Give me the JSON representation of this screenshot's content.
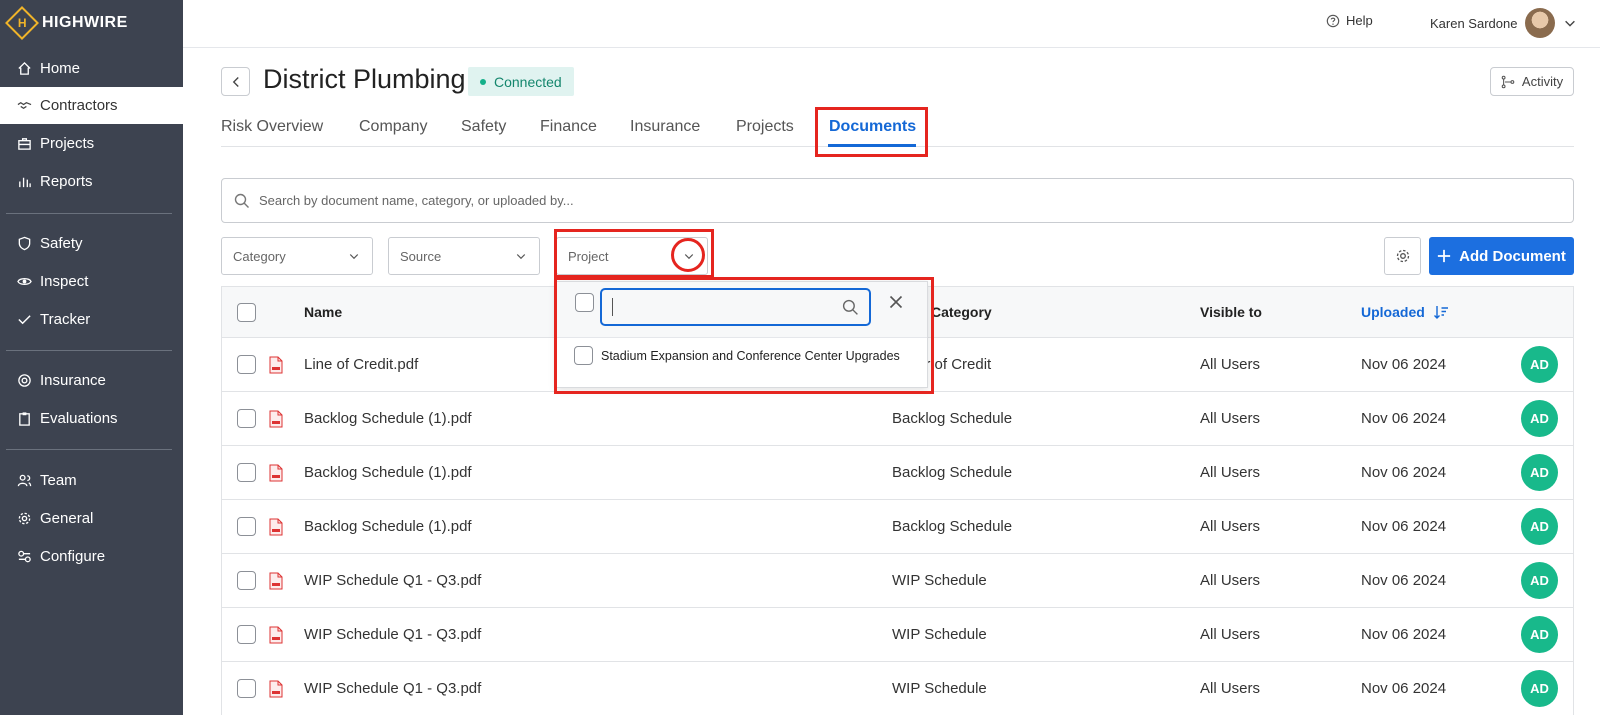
{
  "app": {
    "logo_letter": "H",
    "logo_text": "HIGHWIRE"
  },
  "sidebar": {
    "items": [
      {
        "label": "Home",
        "icon": "home-icon"
      },
      {
        "label": "Contractors",
        "icon": "handshake-icon",
        "active": true
      },
      {
        "label": "Projects",
        "icon": "briefcase-icon"
      },
      {
        "label": "Reports",
        "icon": "bar-chart-icon"
      },
      {
        "label": "Safety",
        "icon": "shield-icon"
      },
      {
        "label": "Inspect",
        "icon": "eye-icon"
      },
      {
        "label": "Tracker",
        "icon": "check-icon"
      },
      {
        "label": "Insurance",
        "icon": "lifebuoy-icon"
      },
      {
        "label": "Evaluations",
        "icon": "clipboard-icon"
      },
      {
        "label": "Team",
        "icon": "users-icon"
      },
      {
        "label": "General",
        "icon": "gear-icon"
      },
      {
        "label": "Configure",
        "icon": "toggle-icon"
      }
    ]
  },
  "topbar": {
    "help_label": "Help",
    "user_name": "Karen Sardone"
  },
  "header": {
    "title": "District Plumbing",
    "status": "Connected",
    "activity_label": "Activity"
  },
  "tabs": [
    "Risk Overview",
    "Company",
    "Safety",
    "Finance",
    "Insurance",
    "Projects",
    "Documents"
  ],
  "search": {
    "placeholder": "Search by document name, category, or uploaded by..."
  },
  "filters": {
    "category": "Category",
    "source": "Source",
    "project": "Project"
  },
  "add_document_label": "Add Document",
  "table": {
    "headers": {
      "name": "Name",
      "category": "Category",
      "visible_to": "Visible to",
      "uploaded": "Uploaded"
    },
    "rows": [
      {
        "name": "Line of Credit.pdf",
        "category": "Letter of Credit",
        "visible": "All Users",
        "uploaded": "Nov 06 2024",
        "by": "AD"
      },
      {
        "name": "Backlog Schedule (1).pdf",
        "category": "Backlog Schedule",
        "visible": "All Users",
        "uploaded": "Nov 06 2024",
        "by": "AD"
      },
      {
        "name": "Backlog Schedule (1).pdf",
        "category": "Backlog Schedule",
        "visible": "All Users",
        "uploaded": "Nov 06 2024",
        "by": "AD"
      },
      {
        "name": "Backlog Schedule (1).pdf",
        "category": "Backlog Schedule",
        "visible": "All Users",
        "uploaded": "Nov 06 2024",
        "by": "AD"
      },
      {
        "name": "WIP Schedule Q1 - Q3.pdf",
        "category": "WIP Schedule",
        "visible": "All Users",
        "uploaded": "Nov 06 2024",
        "by": "AD"
      },
      {
        "name": "WIP Schedule Q1 - Q3.pdf",
        "category": "WIP Schedule",
        "visible": "All Users",
        "uploaded": "Nov 06 2024",
        "by": "AD"
      },
      {
        "name": "WIP Schedule Q1 - Q3.pdf",
        "category": "WIP Schedule",
        "visible": "All Users",
        "uploaded": "Nov 06 2024",
        "by": "AD"
      }
    ]
  },
  "project_dropdown": {
    "search_value": "",
    "options": [
      "Stadium Expansion and Conference Center Upgrades"
    ]
  },
  "colors": {
    "sidebar_bg": "#3d4350",
    "accent": "#1468d6",
    "avatar_green": "#18b98b",
    "highlight_red": "#e5251f",
    "badge_green": "#14866d"
  }
}
